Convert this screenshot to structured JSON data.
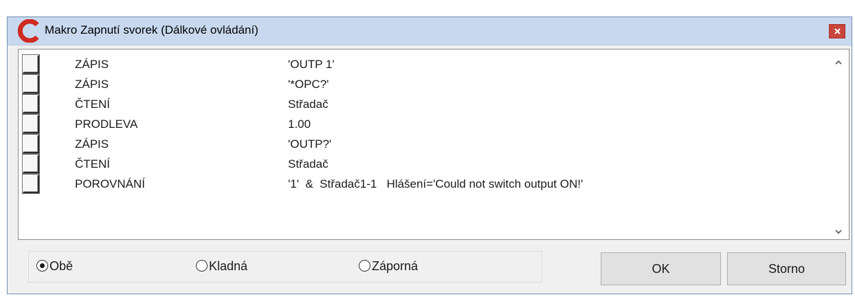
{
  "window": {
    "title": "Makro Zapnutí svorek (Dálkové ovládání)",
    "logo_letter": "C",
    "logo_color": "#d02a21",
    "close_icon": "close-icon"
  },
  "commands": [
    {
      "command": "ZÁPIS",
      "param": "'OUTP 1'"
    },
    {
      "command": "ZÁPIS",
      "param": "'*OPC?'"
    },
    {
      "command": "ČTENÍ",
      "param": "Střadač"
    },
    {
      "command": "PRODLEVA",
      "param": "1.00"
    },
    {
      "command": "ZÁPIS",
      "param": "'OUTP?'"
    },
    {
      "command": "ČTENÍ",
      "param": "Střadač"
    },
    {
      "command": "POROVNÁNÍ",
      "param": "'1'  &  Střadač1-1   Hlášení='Could not switch output ON!'"
    }
  ],
  "polarity": {
    "options": [
      {
        "label": "Obě",
        "selected": true
      },
      {
        "label": "Kladná",
        "selected": false
      },
      {
        "label": "Záporná",
        "selected": false
      }
    ]
  },
  "buttons": {
    "ok": "OK",
    "cancel": "Storno"
  },
  "colors": {
    "titlebar": "#c8d9ef",
    "close_button": "#c9453b",
    "dialog_bg": "#f0f0f0"
  }
}
